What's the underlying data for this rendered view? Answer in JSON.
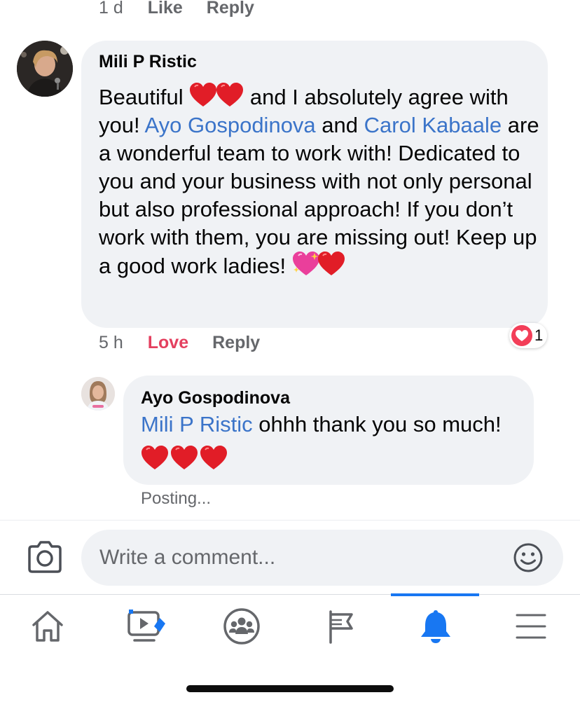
{
  "previous_comment": {
    "time": "1 d",
    "like_label": "Like",
    "reply_label": "Reply"
  },
  "comment": {
    "author": "Mili P Ristic",
    "text_part1": "Beautiful",
    "text_part2": "and I absolutely agree with you!",
    "mention1": "Ayo Gospodinova",
    "text_part3": "and",
    "mention2": "Carol Kabaale",
    "text_part4": "are a wonderful team to work with! Dedicated to you and your business with not only personal but also professional approach! If you don’t work with them, you are missing out! Keep up a good work ladies!",
    "time": "5 h",
    "love_label": "Love",
    "reply_label": "Reply",
    "reaction_count": "1"
  },
  "reply": {
    "author": "Ayo Gospodinova",
    "mention": "Mili P Ristic",
    "text": "ohhh thank you so much!",
    "status": "Posting..."
  },
  "composer": {
    "placeholder": "Write a comment..."
  },
  "nav": {
    "items": [
      "home-icon",
      "video-icon",
      "groups-icon",
      "pages-flag-icon",
      "notifications-bell-icon",
      "menu-icon"
    ],
    "active": "notifications-bell-icon"
  },
  "colors": {
    "link": "#3b74c9",
    "love": "#e4405f",
    "active_nav": "#1877f2",
    "bubble": "#f0f2f5",
    "meta": "#65676b"
  }
}
